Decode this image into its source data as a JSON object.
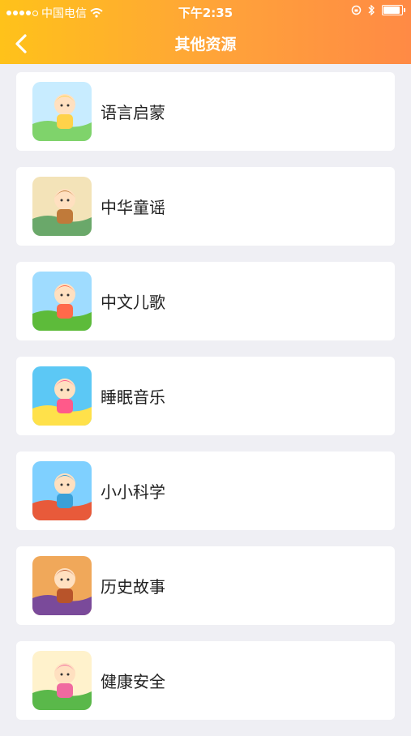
{
  "status_bar": {
    "carrier": "中国电信",
    "time": "下午2:35",
    "battery_level": 0.9
  },
  "nav": {
    "title": "其他资源",
    "back_icon": "chevron-left-icon"
  },
  "resources": [
    {
      "label": "语言启蒙",
      "thumb_colors": [
        "#c8ecff",
        "#ffd24a",
        "#7fd36b"
      ]
    },
    {
      "label": "中华童谣",
      "thumb_colors": [
        "#f3e3b8",
        "#c07a3a",
        "#6aa86a"
      ]
    },
    {
      "label": "中文儿歌",
      "thumb_colors": [
        "#9fdcff",
        "#ff6a4a",
        "#5dbb3a"
      ]
    },
    {
      "label": "睡眠音乐",
      "thumb_colors": [
        "#5cc8f5",
        "#ff5a8a",
        "#ffe14a"
      ]
    },
    {
      "label": "小小科学",
      "thumb_colors": [
        "#7fd0ff",
        "#3aa0d8",
        "#e85a3a"
      ]
    },
    {
      "label": "历史故事",
      "thumb_colors": [
        "#f0a85a",
        "#b8542a",
        "#7a4a9a"
      ]
    },
    {
      "label": "健康安全",
      "thumb_colors": [
        "#fff2cc",
        "#f06aa0",
        "#5ab84a"
      ]
    }
  ]
}
